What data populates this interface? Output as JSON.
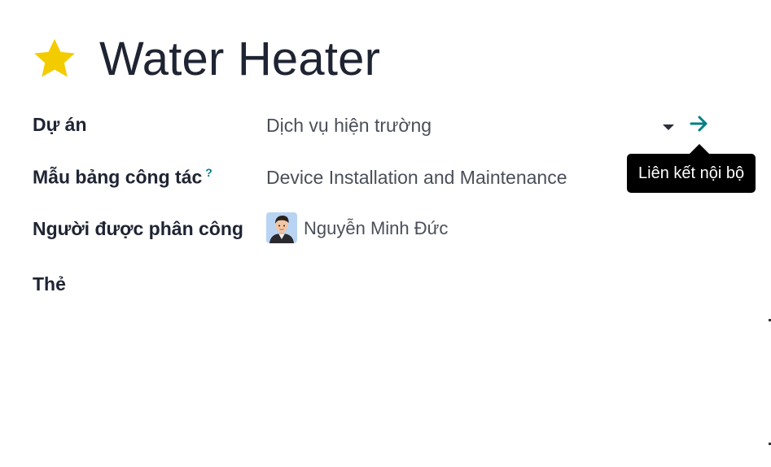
{
  "task": {
    "title": "Water Heater",
    "favorite_icon": "star-icon",
    "favorite_color": "#f3cc00"
  },
  "fields": {
    "project": {
      "label": "Dự án",
      "value": "Dịch vụ hiện trường",
      "link_icon": "arrow-right-icon",
      "link_tooltip": "Liên kết nội bộ"
    },
    "worksheet_template": {
      "label": "Mẫu bảng công tác",
      "help": "?",
      "value": "Device Installation and Maintenance"
    },
    "assignees": {
      "label": "Người được phân công",
      "value": "Nguyễn Minh Đức"
    },
    "tags": {
      "label": "Thẻ"
    }
  },
  "colors": {
    "accent": "#017e84",
    "star": "#f3cc00",
    "tooltip_bg": "#000000"
  }
}
